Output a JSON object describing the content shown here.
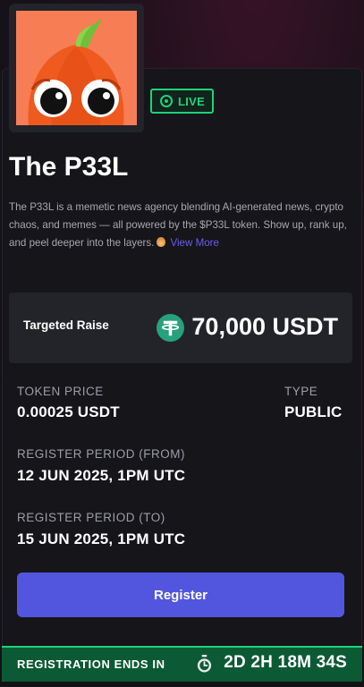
{
  "project": {
    "name": "The P33L",
    "status": "LIVE",
    "description": "The P33L is a memetic news agency blending AI-generated news, crypto chaos, and memes — all powered by the $P33L token. Show up, rank up, and peel deeper into the layers.",
    "view_more_label": "View More"
  },
  "raise": {
    "label": "Targeted Raise",
    "amount": "70,000 USDT",
    "currency_icon": "usdt-tether-icon"
  },
  "details": {
    "token_price_label": "TOKEN PRICE",
    "token_price_value": "0.00025 USDT",
    "type_label": "TYPE",
    "type_value": "PUBLIC",
    "register_from_label": "REGISTER PERIOD (FROM)",
    "register_from_value": "12 JUN 2025, 1PM UTC",
    "register_to_label": "REGISTER PERIOD (TO)",
    "register_to_value": "15 JUN 2025, 1PM UTC"
  },
  "actions": {
    "register_label": "Register"
  },
  "footer": {
    "label": "REGISTRATION ENDS IN",
    "countdown": "2D 2H 18M 34S",
    "timer_icon": "stopwatch-icon"
  },
  "colors": {
    "accent_green": "#1fd17a",
    "button_purple": "#5256de",
    "link_purple": "#6b5cf0",
    "footer_green": "#0c5a35",
    "usdt_green": "#26a17b"
  }
}
